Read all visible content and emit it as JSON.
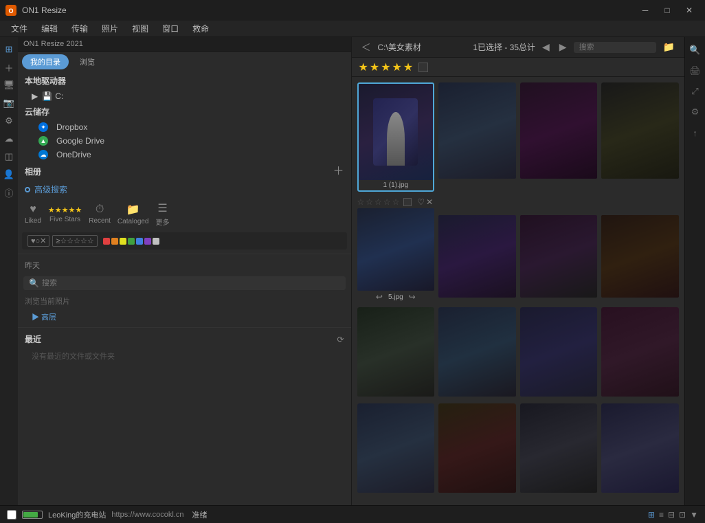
{
  "titlebar": {
    "title": "ON1 Resize",
    "app_icon": "ON1",
    "min_btn": "─",
    "max_btn": "□",
    "close_btn": "✕"
  },
  "menubar": {
    "items": [
      "文件",
      "编辑",
      "传输",
      "照片",
      "视图",
      "窗口",
      "救命"
    ]
  },
  "sidebar": {
    "tabs": [
      {
        "label": "我的目录",
        "active": true
      },
      {
        "label": "浏览",
        "active": false
      }
    ],
    "local_drives_label": "本地驱动器",
    "drives": [
      {
        "label": "C:"
      }
    ],
    "cloud_label": "云储存",
    "cloud_items": [
      {
        "label": "Dropbox",
        "color": "#0070e0"
      },
      {
        "label": "Google Drive",
        "color": "#34a853"
      },
      {
        "label": "OneDrive",
        "color": "#0078d4"
      }
    ],
    "album_label": "相册",
    "smart_filter_label": "高级搜索",
    "quick_filters": [
      {
        "label": "Liked",
        "icon": "♥"
      },
      {
        "label": "Five Stars",
        "icon": "★★★★★"
      },
      {
        "label": "Recent",
        "icon": "⏱"
      },
      {
        "label": "Cataloged",
        "icon": "📁"
      },
      {
        "label": "更多",
        "icon": "☰"
      }
    ],
    "filter_row": {
      "heart_filter": "♥○✕",
      "star_filter": "≥☆☆☆☆☆",
      "colors": [
        "#e04040",
        "#e08020",
        "#e0e020",
        "#40a040",
        "#4080e0",
        "#8040c0",
        "#e0e0e0"
      ]
    },
    "search_placeholder": "搜索",
    "albums_label": "最近",
    "no_recent_label": "没有最近的文件或文件夹",
    "recent_section": {
      "label": "最近",
      "sub_label": "> 高层"
    }
  },
  "content": {
    "nav": {
      "back_label": "＜",
      "forward_label": "＞",
      "path": "C:\\美女素材"
    },
    "selection_info": "1已选择 - 35总计",
    "search_placeholder": "搜索",
    "rating_stars": [
      "★",
      "★",
      "★",
      "★",
      "★"
    ],
    "photos": [
      {
        "id": 1,
        "name": "1 (1).jpg",
        "selected": true,
        "ph": "ph1"
      },
      {
        "id": 2,
        "name": "",
        "selected": false,
        "ph": "ph2"
      },
      {
        "id": 3,
        "name": "",
        "selected": false,
        "ph": "ph3"
      },
      {
        "id": 4,
        "name": "",
        "selected": false,
        "ph": "ph4"
      },
      {
        "id": 5,
        "name": "5.jpg",
        "selected": false,
        "ph": "ph2",
        "rating_row": true
      },
      {
        "id": 6,
        "name": "",
        "selected": false,
        "ph": "ph1"
      },
      {
        "id": 7,
        "name": "",
        "selected": false,
        "ph": "ph3"
      },
      {
        "id": 8,
        "name": "",
        "selected": false,
        "ph": "ph5"
      },
      {
        "id": 9,
        "name": "",
        "selected": false,
        "ph": "ph4"
      },
      {
        "id": 10,
        "name": "",
        "selected": false,
        "ph": "ph2"
      },
      {
        "id": 11,
        "name": "",
        "selected": false,
        "ph": "ph1"
      },
      {
        "id": 12,
        "name": "",
        "selected": false,
        "ph": "ph3"
      },
      {
        "id": 13,
        "name": "",
        "selected": false,
        "ph": "ph2"
      },
      {
        "id": 14,
        "name": "",
        "selected": false,
        "ph": "ph5"
      },
      {
        "id": 15,
        "name": "",
        "selected": false,
        "ph": "ph4"
      },
      {
        "id": 16,
        "name": "",
        "selected": false,
        "ph": "ph1"
      }
    ]
  },
  "bottombar": {
    "battery_label": "LeoKing的充电站",
    "url_label": "https://www.cocokl.cn",
    "status_label": "准绪",
    "view_icons": [
      "⊞",
      "⊟",
      "⊠",
      "⊡"
    ]
  },
  "right_panel": {
    "icons": [
      "🔍",
      "🖨",
      "🔧",
      "↑",
      "⊕",
      "⊖"
    ]
  }
}
